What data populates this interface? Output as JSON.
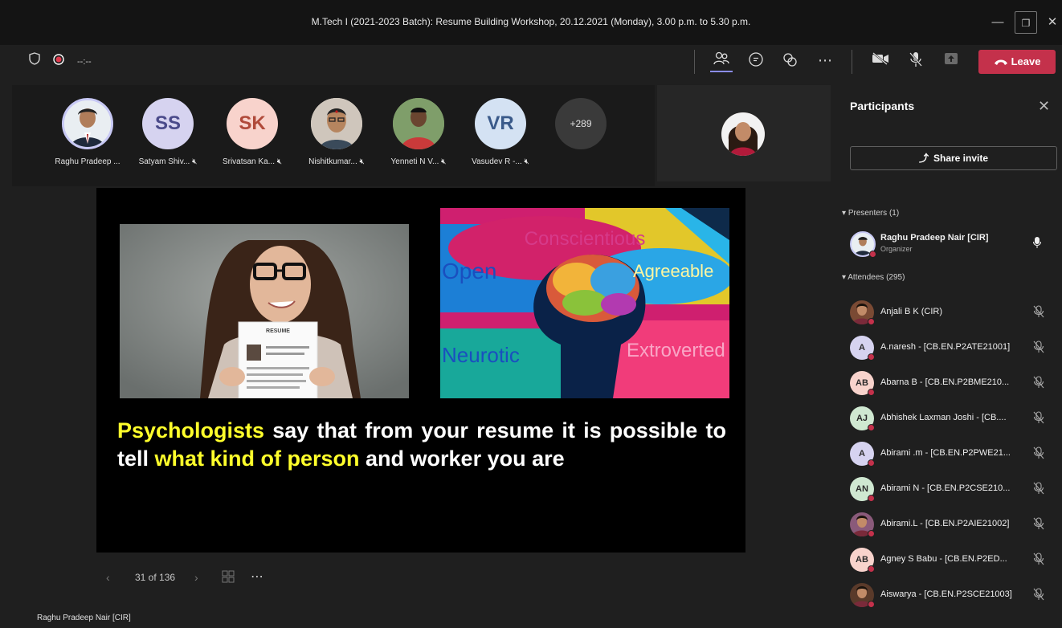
{
  "window": {
    "title": "M.Tech I (2021-2023 Batch): Resume Building Workshop, 20.12.2021 (Monday), 3.00 p.m. to 5.30 p.m.",
    "minimize_icon": "minimize-icon",
    "maximize_icon": "restore-icon",
    "close_icon": "close-icon"
  },
  "toolbar": {
    "shield_icon": "shield-icon",
    "record_icon": "record-icon",
    "timer": "--:--",
    "leave_label": "Leave",
    "icons": [
      "people-icon",
      "chat-icon",
      "reactions-icon",
      "more-icon",
      "camera-off-icon",
      "mic-off-icon",
      "share-tray-icon",
      "phone-hangup-icon"
    ],
    "colors": {
      "leave": "#c4314b",
      "background": "#1f1f1f"
    }
  },
  "strip": {
    "participants": [
      {
        "name": "Raghu Pradeep ...",
        "initials": "",
        "avatar_color": "#7a5a44",
        "muted": false
      },
      {
        "name": "Satyam Shiv...",
        "initials": "SS",
        "avatar_color": "#d6d3f0",
        "text_color": "#4a4a8a",
        "muted": true
      },
      {
        "name": "Srivatsan Ka...",
        "initials": "SK",
        "avatar_color": "#f8d3cc",
        "text_color": "#b04a3a",
        "muted": true
      },
      {
        "name": "Nishitkumar...",
        "initials": "",
        "avatar_color": "#8a6a54",
        "muted": true
      },
      {
        "name": "Yenneti N V...",
        "initials": "",
        "avatar_color": "#9e3a34",
        "muted": true
      },
      {
        "name": "Vasudev R -...",
        "initials": "VR",
        "avatar_color": "#d4e2f3",
        "text_color": "#3a5a8a",
        "muted": true
      }
    ],
    "overflow_count": "+289"
  },
  "slide": {
    "text_before": "",
    "highlight1": "Psychologists",
    "text_middle": " say that from your resume it is possible to tell ",
    "highlight2": "what kind of person",
    "text_after": " and worker you are",
    "img2_words": [
      "Conscientious",
      "Open",
      "Agreeable",
      "Neurotic",
      "Extroverted"
    ],
    "img1_paper_label": "RESUME",
    "colors": {
      "highlight": "#ffff2b",
      "text": "#ffffff"
    }
  },
  "slide_nav": {
    "page": "31 of 136",
    "prev_icon": "chevron-left-icon",
    "next_icon": "chevron-right-icon",
    "grid_icon": "slides-grid-icon",
    "more_icon": "more-icon"
  },
  "presenter_label": "Raghu Pradeep Nair [CIR]",
  "panel": {
    "title": "Participants",
    "share_label": "Share invite",
    "presenters_header": "Presenters (1)",
    "attendees_header": "Attendees (295)",
    "presenter": {
      "name": "Raghu Pradeep Nair [CIR]",
      "role": "Organizer"
    },
    "attendees": [
      {
        "name": "Anjali B K (CIR)",
        "initials": "",
        "color": "#7a4a34"
      },
      {
        "name": "A.naresh - [CB.EN.P2ATE21001]",
        "initials": "A",
        "color": "#d6d3f0"
      },
      {
        "name": "Abarna B - [CB.EN.P2BME210...",
        "initials": "AB",
        "color": "#f8d3cc"
      },
      {
        "name": "Abhishek Laxman Joshi - [CB....",
        "initials": "AJ",
        "color": "#cfe8d1"
      },
      {
        "name": "Abirami .m - [CB.EN.P2PWE21...",
        "initials": "A",
        "color": "#d6d3f0"
      },
      {
        "name": "Abirami N - [CB.EN.P2CSE210...",
        "initials": "AN",
        "color": "#cfe8d1"
      },
      {
        "name": "Abirami.L - [CB.EN.P2AIE21002]",
        "initials": "",
        "color": "#8a5a7a"
      },
      {
        "name": "Agney S Babu - [CB.EN.P2ED...",
        "initials": "AB",
        "color": "#f8d3cc"
      },
      {
        "name": "Aiswarya - [CB.EN.P2SCE21003]",
        "initials": "",
        "color": "#5a3a2a"
      }
    ]
  }
}
